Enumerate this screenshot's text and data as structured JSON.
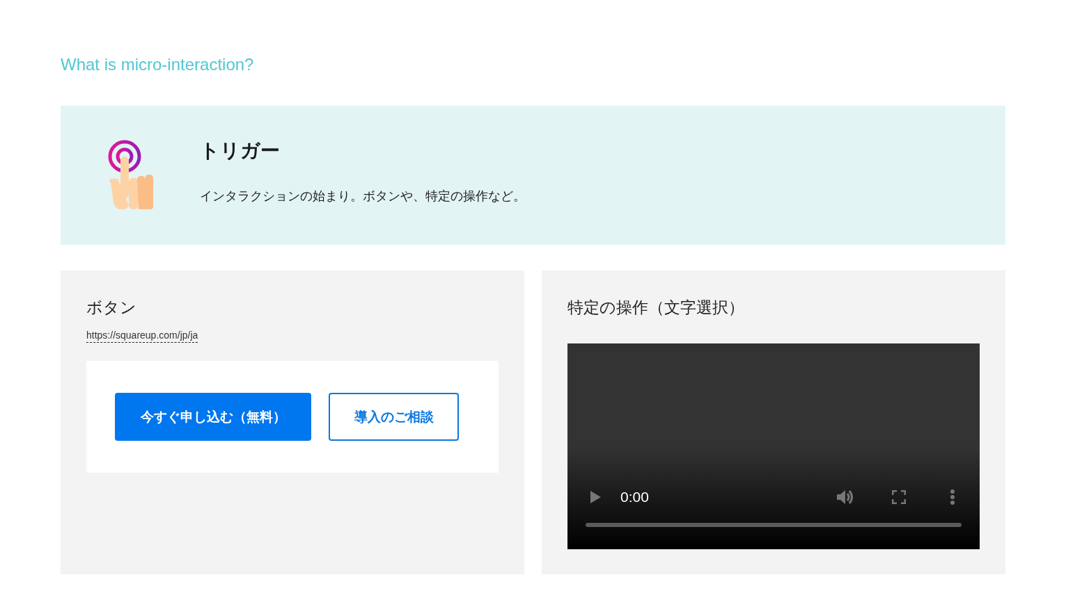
{
  "heading": "What is micro-interaction?",
  "trigger": {
    "title": "トリガー",
    "description": "インタラクションの始まり。ボタンや、特定の操作など。"
  },
  "panels": [
    {
      "kind": "buttons",
      "title": "ボタン",
      "link": "https://squareup.com/jp/ja",
      "buttons": [
        {
          "label": "今すぐ申し込む（無料）",
          "kind": "primary"
        },
        {
          "label": "導入のご相談",
          "kind": "outline"
        }
      ]
    },
    {
      "kind": "video",
      "title": "特定の操作（文字選択）",
      "time": "0:00"
    }
  ]
}
